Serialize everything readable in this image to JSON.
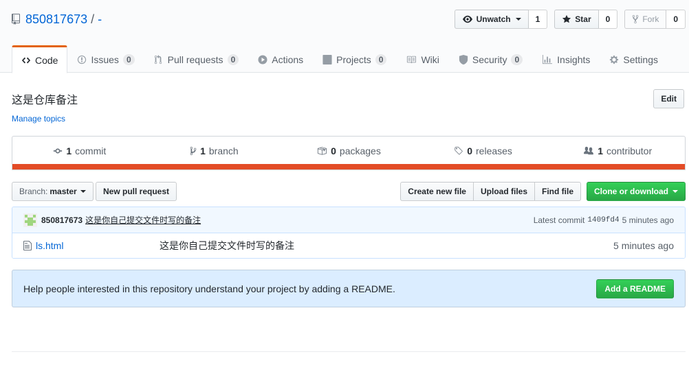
{
  "repo": {
    "owner": "850817673",
    "separator": "/",
    "name": "-"
  },
  "actions": {
    "watch_label": "Unwatch",
    "watch_count": "1",
    "star_label": "Star",
    "star_count": "0",
    "fork_label": "Fork",
    "fork_count": "0"
  },
  "nav": {
    "code": "Code",
    "issues": "Issues",
    "issues_count": "0",
    "pulls": "Pull requests",
    "pulls_count": "0",
    "actions": "Actions",
    "projects": "Projects",
    "projects_count": "0",
    "wiki": "Wiki",
    "security": "Security",
    "security_count": "0",
    "insights": "Insights",
    "settings": "Settings"
  },
  "description": "这是仓库备注",
  "manage_topics": "Manage topics",
  "edit_label": "Edit",
  "summary": {
    "commits_num": "1",
    "commits_label": "commit",
    "branches_num": "1",
    "branches_label": "branch",
    "packages_num": "0",
    "packages_label": "packages",
    "releases_num": "0",
    "releases_label": "releases",
    "contributors_num": "1",
    "contributors_label": "contributor",
    "language_color": "#e34c26"
  },
  "file_nav": {
    "branch_label": "Branch:",
    "branch_value": "master",
    "new_pr": "New pull request",
    "create_file": "Create new file",
    "upload_files": "Upload files",
    "find_file": "Find file",
    "clone": "Clone or download"
  },
  "commit": {
    "author": "850817673",
    "message": "这是你自己提交文件时写的备注",
    "latest_label": "Latest commit",
    "sha": "1409fd4",
    "age": "5 minutes ago"
  },
  "files": [
    {
      "name": "ls.html",
      "message": "这是你自己提交文件时写的备注",
      "age": "5 minutes ago"
    }
  ],
  "readme_banner": {
    "text": "Help people interested in this repository understand your project by adding a README.",
    "button": "Add a README"
  }
}
